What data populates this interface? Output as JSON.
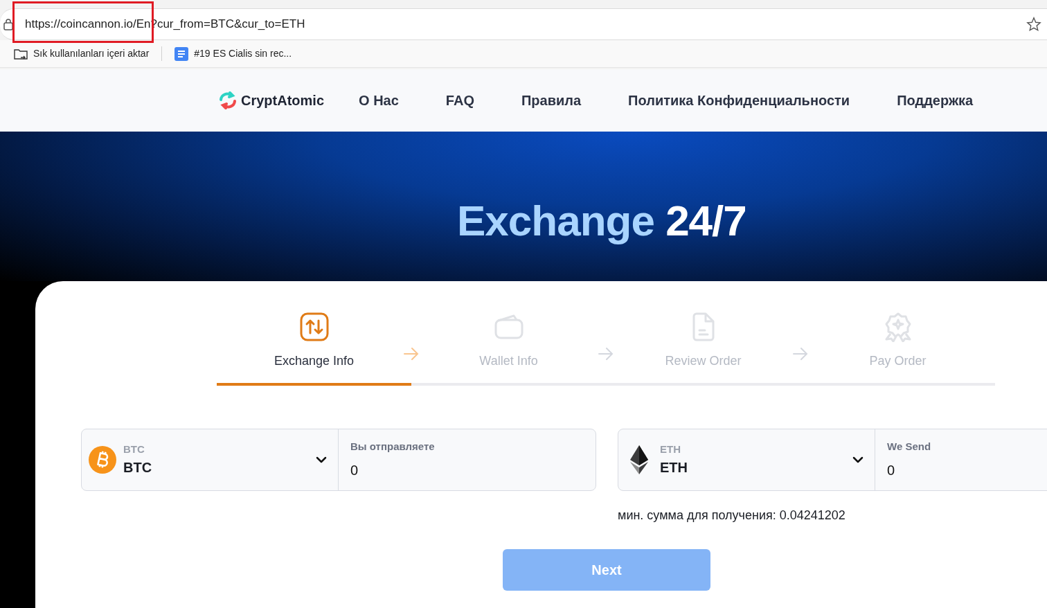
{
  "browser": {
    "url": "https://coincannon.io/En?cur_from=BTC&cur_to=ETH",
    "bookmarks": [
      {
        "kind": "folder",
        "label": "Sık kullanılanları içeri aktar"
      },
      {
        "kind": "doc",
        "label": "#19 ES Cialis sin rec..."
      }
    ]
  },
  "nav": {
    "logo": "CryptAtomic",
    "links": [
      "О Нас",
      "FAQ",
      "Правила",
      "Политика Конфиденциальности",
      "Поддержка"
    ]
  },
  "hero": {
    "title_a": "Exchange",
    "title_b": "24/7"
  },
  "steps": [
    {
      "kind": "exchange",
      "label": "Exchange Info",
      "selected": true
    },
    {
      "kind": "wallet",
      "label": "Wallet Info",
      "selected": false
    },
    {
      "kind": "review",
      "label": "Review Order",
      "selected": false
    },
    {
      "kind": "pay",
      "label": "Pay Order",
      "selected": false
    }
  ],
  "pairs": [
    {
      "kind": "btc",
      "small": "BTC",
      "currency": "BTC",
      "amount_label": "Вы отправляете",
      "amount": "0"
    },
    {
      "kind": "eth",
      "small": "ETH",
      "currency": "ETH",
      "amount_label": "We Send",
      "amount": "0"
    }
  ],
  "min_note": "мин. сумма для получения: 0.04241202",
  "next_button": {
    "label": "Next",
    "disabled": true
  }
}
